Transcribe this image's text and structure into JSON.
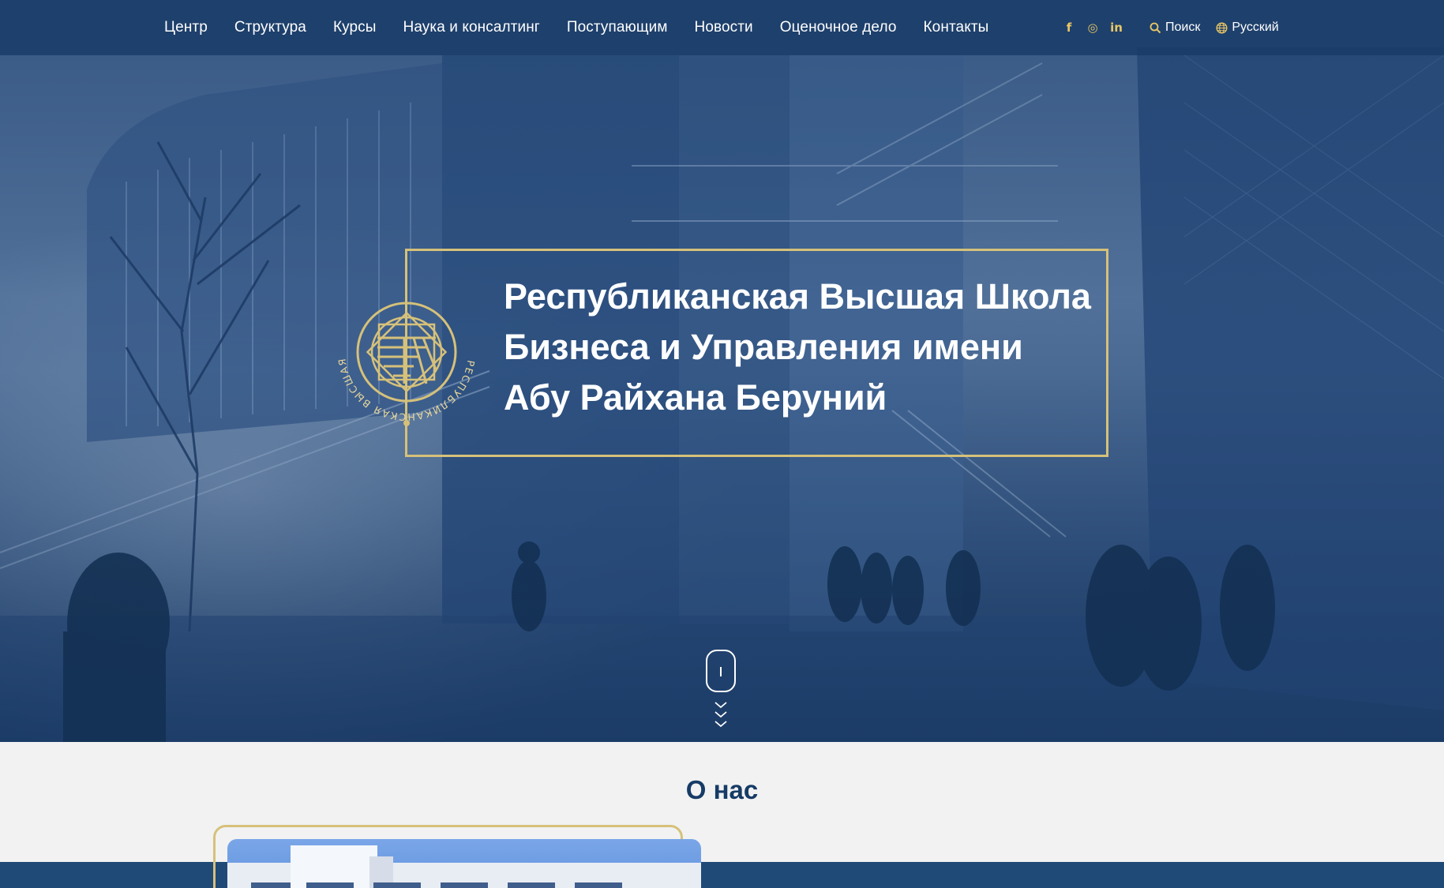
{
  "nav": {
    "items": [
      {
        "label": "Центр"
      },
      {
        "label": "Структура"
      },
      {
        "label": "Курсы"
      },
      {
        "label": "Наука и консалтинг"
      },
      {
        "label": "Поступающим"
      },
      {
        "label": "Новости"
      },
      {
        "label": "Оценочное дело"
      },
      {
        "label": "Контакты"
      }
    ],
    "social": [
      {
        "icon": "facebook-icon",
        "glyph": "f"
      },
      {
        "icon": "instagram-icon",
        "glyph": "◎"
      },
      {
        "icon": "linkedin-icon",
        "glyph": "in"
      }
    ],
    "search_label": "Поиск",
    "language_label": "Русский"
  },
  "hero": {
    "title_lines": [
      "Республиканская Высшая Школа",
      "Бизнеса и Управления имени",
      "Абу Райхана Беруний"
    ],
    "emblem_text": "РЕСПУБЛИКАНСКАЯ ВЫСШАЯ ШКОЛА БИЗНЕСА И УПРАВЛЕНИЯ"
  },
  "about": {
    "title": "О нас"
  },
  "colors": {
    "accent_gold": "#d6c17a",
    "nav_bg": "#183a66",
    "heading_blue": "#163b66"
  }
}
